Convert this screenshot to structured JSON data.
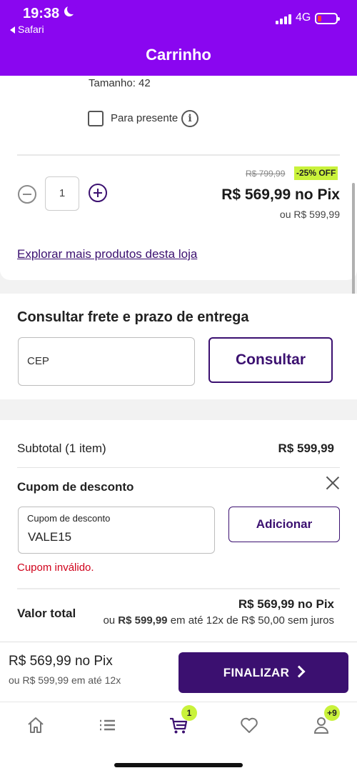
{
  "status_bar": {
    "time": "19:38",
    "back_label": "Safari",
    "network": "4G"
  },
  "header": {
    "title": "Carrinho"
  },
  "product": {
    "size_label": "Tamanho: 42",
    "gift_label": "Para presente",
    "quantity": "1",
    "old_price": "R$ 799,99",
    "discount_badge": "-25% OFF",
    "pix_price": "R$ 569,99 no Pix",
    "card_price": "ou R$ 599,99",
    "explore_link": "Explorar mais produtos desta loja"
  },
  "freight": {
    "title": "Consultar frete e prazo de entrega",
    "cep_placeholder": "CEP",
    "consult_label": "Consultar"
  },
  "summary": {
    "subtotal_label": "Subtotal (1 item)",
    "subtotal_value": "R$ 599,99",
    "coupon_title": "Cupom de desconto",
    "coupon_field_label": "Cupom de desconto",
    "coupon_value": "VALE15",
    "add_label": "Adicionar",
    "coupon_error": "Cupom inválido.",
    "total_label": "Valor total",
    "total_pix": "R$ 569,99 no Pix",
    "total_prefix": "ou",
    "total_amount": "R$ 599,99",
    "total_suffix": "em até 12x de R$ 50,00 sem juros"
  },
  "bottom_bar": {
    "pix_price": "R$ 569,99 no Pix",
    "installments": "ou R$ 599,99 em até 12x",
    "finalize_label": "FINALIZAR"
  },
  "tabbar": {
    "cart_badge": "1",
    "account_badge": "+9",
    "icons": [
      "home-icon",
      "list-icon",
      "cart-icon",
      "heart-icon",
      "user-icon"
    ]
  },
  "colors": {
    "brand": "#8a06f0",
    "primary": "#3b1070",
    "accent": "#c9f23b",
    "error": "#d0021b"
  }
}
